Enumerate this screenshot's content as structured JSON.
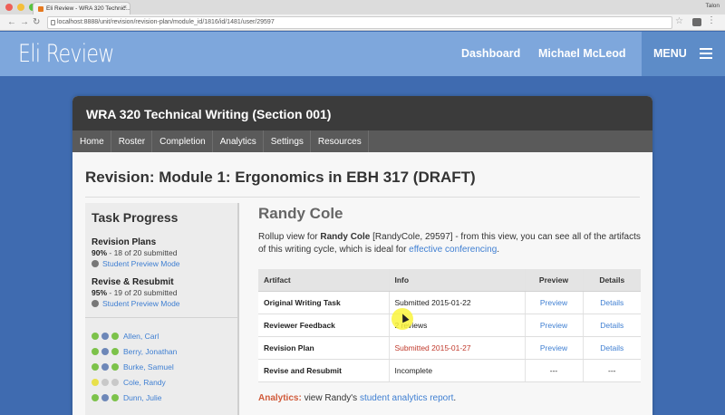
{
  "browser": {
    "tab_title": "Eli Review - WRA 320 Technic...",
    "tab_close": "×",
    "user_label": "Talon",
    "url": "localhost:8888/unit/revision/revision-plan/module_id/1816/id/1481/user/29597",
    "back_glyph": "←",
    "forward_glyph": "→",
    "reload_glyph": "↻",
    "star_glyph": "☆",
    "kebab_glyph": "⋮",
    "window_dot_colors": [
      "#ee5f57",
      "#f5be3a",
      "#58c440"
    ]
  },
  "header": {
    "logo": "Eli Review",
    "dashboard_link": "Dashboard",
    "user_link": "Michael McLeod",
    "menu_label": "MENU"
  },
  "course": {
    "title": "WRA 320 Technical Writing (Section 001)",
    "nav": [
      "Home",
      "Roster",
      "Completion",
      "Analytics",
      "Settings",
      "Resources"
    ]
  },
  "page_title": "Revision: Module 1: Ergonomics in EBH 317 (DRAFT)",
  "sidebar": {
    "heading": "Task Progress",
    "tasks": [
      {
        "title": "Revision Plans",
        "percent": "90%",
        "summary": " - 18 of 20 submitted",
        "link": "Student Preview Mode"
      },
      {
        "title": "Revise & Resubmit",
        "percent": "95%",
        "summary": " - 19 of 20 submitted",
        "link": "Student Preview Mode"
      }
    ],
    "students": [
      {
        "name": "Allen, Carl",
        "status_color": "#7cc24a",
        "person_color": "#6d87b8",
        "dot3_color": "#7cc24a"
      },
      {
        "name": "Berry, Jonathan",
        "status_color": "#7cc24a",
        "person_color": "#6d87b8",
        "dot3_color": "#7cc24a"
      },
      {
        "name": "Burke, Samuel",
        "status_color": "#7cc24a",
        "person_color": "#6d87b8",
        "dot3_color": "#7cc24a"
      },
      {
        "name": "Cole, Randy",
        "status_color": "#e8e04a",
        "person_color": "#c8c8c8",
        "dot3_color": "#c8c8c8"
      },
      {
        "name": "Dunn, Julie",
        "status_color": "#7cc24a",
        "person_color": "#6d87b8",
        "dot3_color": "#7cc24a"
      }
    ]
  },
  "main": {
    "student_name": "Randy Cole",
    "desc_prefix": "Rollup view for ",
    "desc_name": "Randy Cole",
    "desc_middle": " [RandyCole, 29597] - from this view, you can see all of the artifacts of this writing cycle, which is ideal for ",
    "desc_link": "effective conferencing",
    "desc_suffix": ".",
    "table": {
      "headers": [
        "Artifact",
        "Info",
        "Preview",
        "Details"
      ],
      "rows": [
        {
          "artifact": "Original Writing Task",
          "info": "Submitted 2015-01-22",
          "preview": "Preview",
          "details": "Details",
          "info_color": "#222222"
        },
        {
          "artifact": "Reviewer Feedback",
          "info": "2 reviews",
          "preview": "Preview",
          "details": "Details",
          "info_color": "#222222"
        },
        {
          "artifact": "Revision Plan",
          "info": "Submitted 2015-01-27",
          "preview": "Preview",
          "details": "Details",
          "info_color": "#c0392b"
        },
        {
          "artifact": "Revise and Resubmit",
          "info": "Incomplete",
          "preview": "---",
          "details": "---",
          "info_color": "#222222"
        }
      ]
    },
    "analytics_label": "Analytics:",
    "analytics_text": " view Randy's ",
    "analytics_link": "student analytics report",
    "analytics_suffix": "."
  }
}
